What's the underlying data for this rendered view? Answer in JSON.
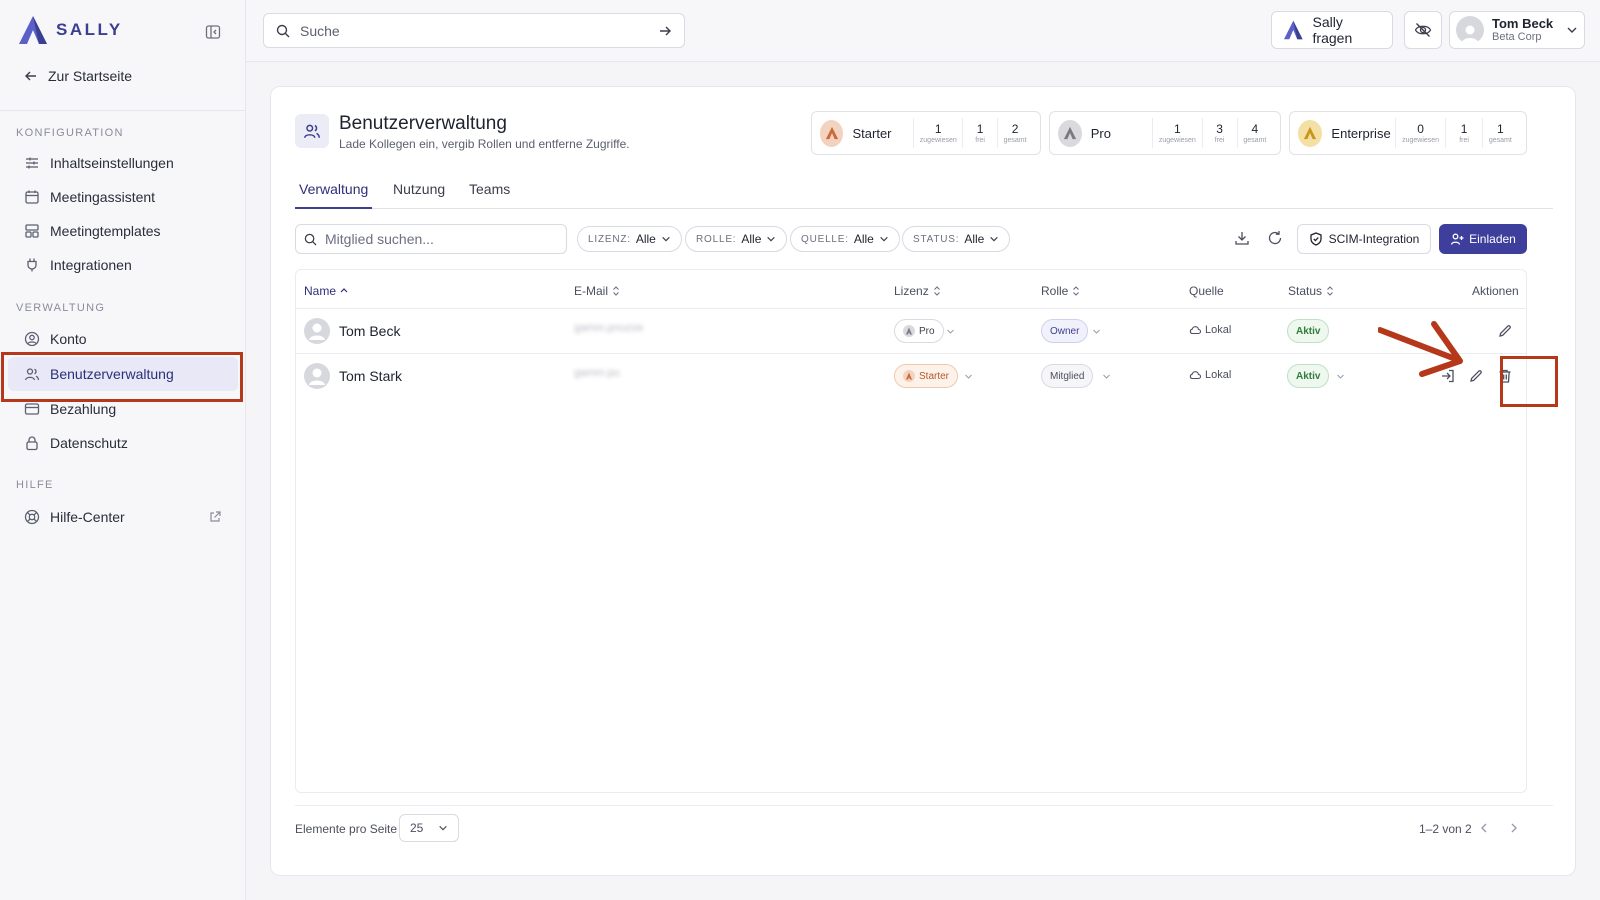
{
  "brand": {
    "name": "SALLY"
  },
  "sidebar": {
    "back_label": "Zur Startseite",
    "sections": [
      {
        "title": "KONFIGURATION",
        "items": [
          {
            "label": "Inhaltseinstellungen",
            "icon": "sliders-icon"
          },
          {
            "label": "Meetingassistent",
            "icon": "calendar-icon"
          },
          {
            "label": "Meetingtemplates",
            "icon": "template-icon"
          },
          {
            "label": "Integrationen",
            "icon": "plug-icon"
          }
        ]
      },
      {
        "title": "VERWALTUNG",
        "items": [
          {
            "label": "Konto",
            "icon": "user-circle-icon"
          },
          {
            "label": "Benutzerverwaltung",
            "icon": "users-icon",
            "active": true
          },
          {
            "label": "Bezahlung",
            "icon": "credit-card-icon"
          },
          {
            "label": "Datenschutz",
            "icon": "lock-icon"
          }
        ]
      },
      {
        "title": "HILFE",
        "items": [
          {
            "label": "Hilfe-Center",
            "icon": "lifebuoy-icon",
            "external": true
          }
        ]
      }
    ]
  },
  "topbar": {
    "search_placeholder": "Suche",
    "ask_label": "Sally fragen",
    "user": {
      "name": "Tom Beck",
      "org": "Beta Corp"
    }
  },
  "page": {
    "title": "Benutzerverwaltung",
    "subtitle": "Lade Kollegen ein, vergib Rollen und entferne Zugriffe."
  },
  "licenses": [
    {
      "name": "Starter",
      "assigned": "1",
      "free": "1",
      "total": "2",
      "color": "#e08a5a"
    },
    {
      "name": "Pro",
      "assigned": "1",
      "free": "3",
      "total": "4",
      "color": "#9a9aa3"
    },
    {
      "name": "Enterprise",
      "assigned": "0",
      "free": "1",
      "total": "1",
      "color": "#e2b43a"
    }
  ],
  "license_labels": {
    "assigned": "zugewiesen",
    "free": "frei",
    "total": "gesamt"
  },
  "tabs": [
    "Verwaltung",
    "Nutzung",
    "Teams"
  ],
  "toolbar": {
    "member_search_placeholder": "Mitglied suchen...",
    "filters": [
      {
        "key": "LIZENZ:",
        "value": "Alle"
      },
      {
        "key": "ROLLE:",
        "value": "Alle"
      },
      {
        "key": "QUELLE:",
        "value": "Alle"
      },
      {
        "key": "STATUS:",
        "value": "Alle"
      }
    ],
    "scim_label": "SCIM-Integration",
    "invite_label": "Einladen"
  },
  "table": {
    "columns": [
      "Name",
      "E-Mail",
      "Lizenz",
      "Rolle",
      "Quelle",
      "Status",
      "Aktionen"
    ],
    "rows": [
      {
        "name": "Tom Beck",
        "email": "gamm.pnuzze",
        "license": "Pro",
        "role": "Owner",
        "source": "Lokal",
        "status": "Aktiv"
      },
      {
        "name": "Tom Stark",
        "email": "gamm.pu",
        "license": "Starter",
        "role": "Mitglied",
        "source": "Lokal",
        "status": "Aktiv"
      }
    ]
  },
  "pagination": {
    "per_page_label": "Elemente pro Seite",
    "per_page_value": "25",
    "range_label": "1–2 von 2"
  },
  "colors": {
    "accent": "#3e3f9c",
    "highlight": "#b5381b",
    "status_green": "#2f7d3a"
  }
}
